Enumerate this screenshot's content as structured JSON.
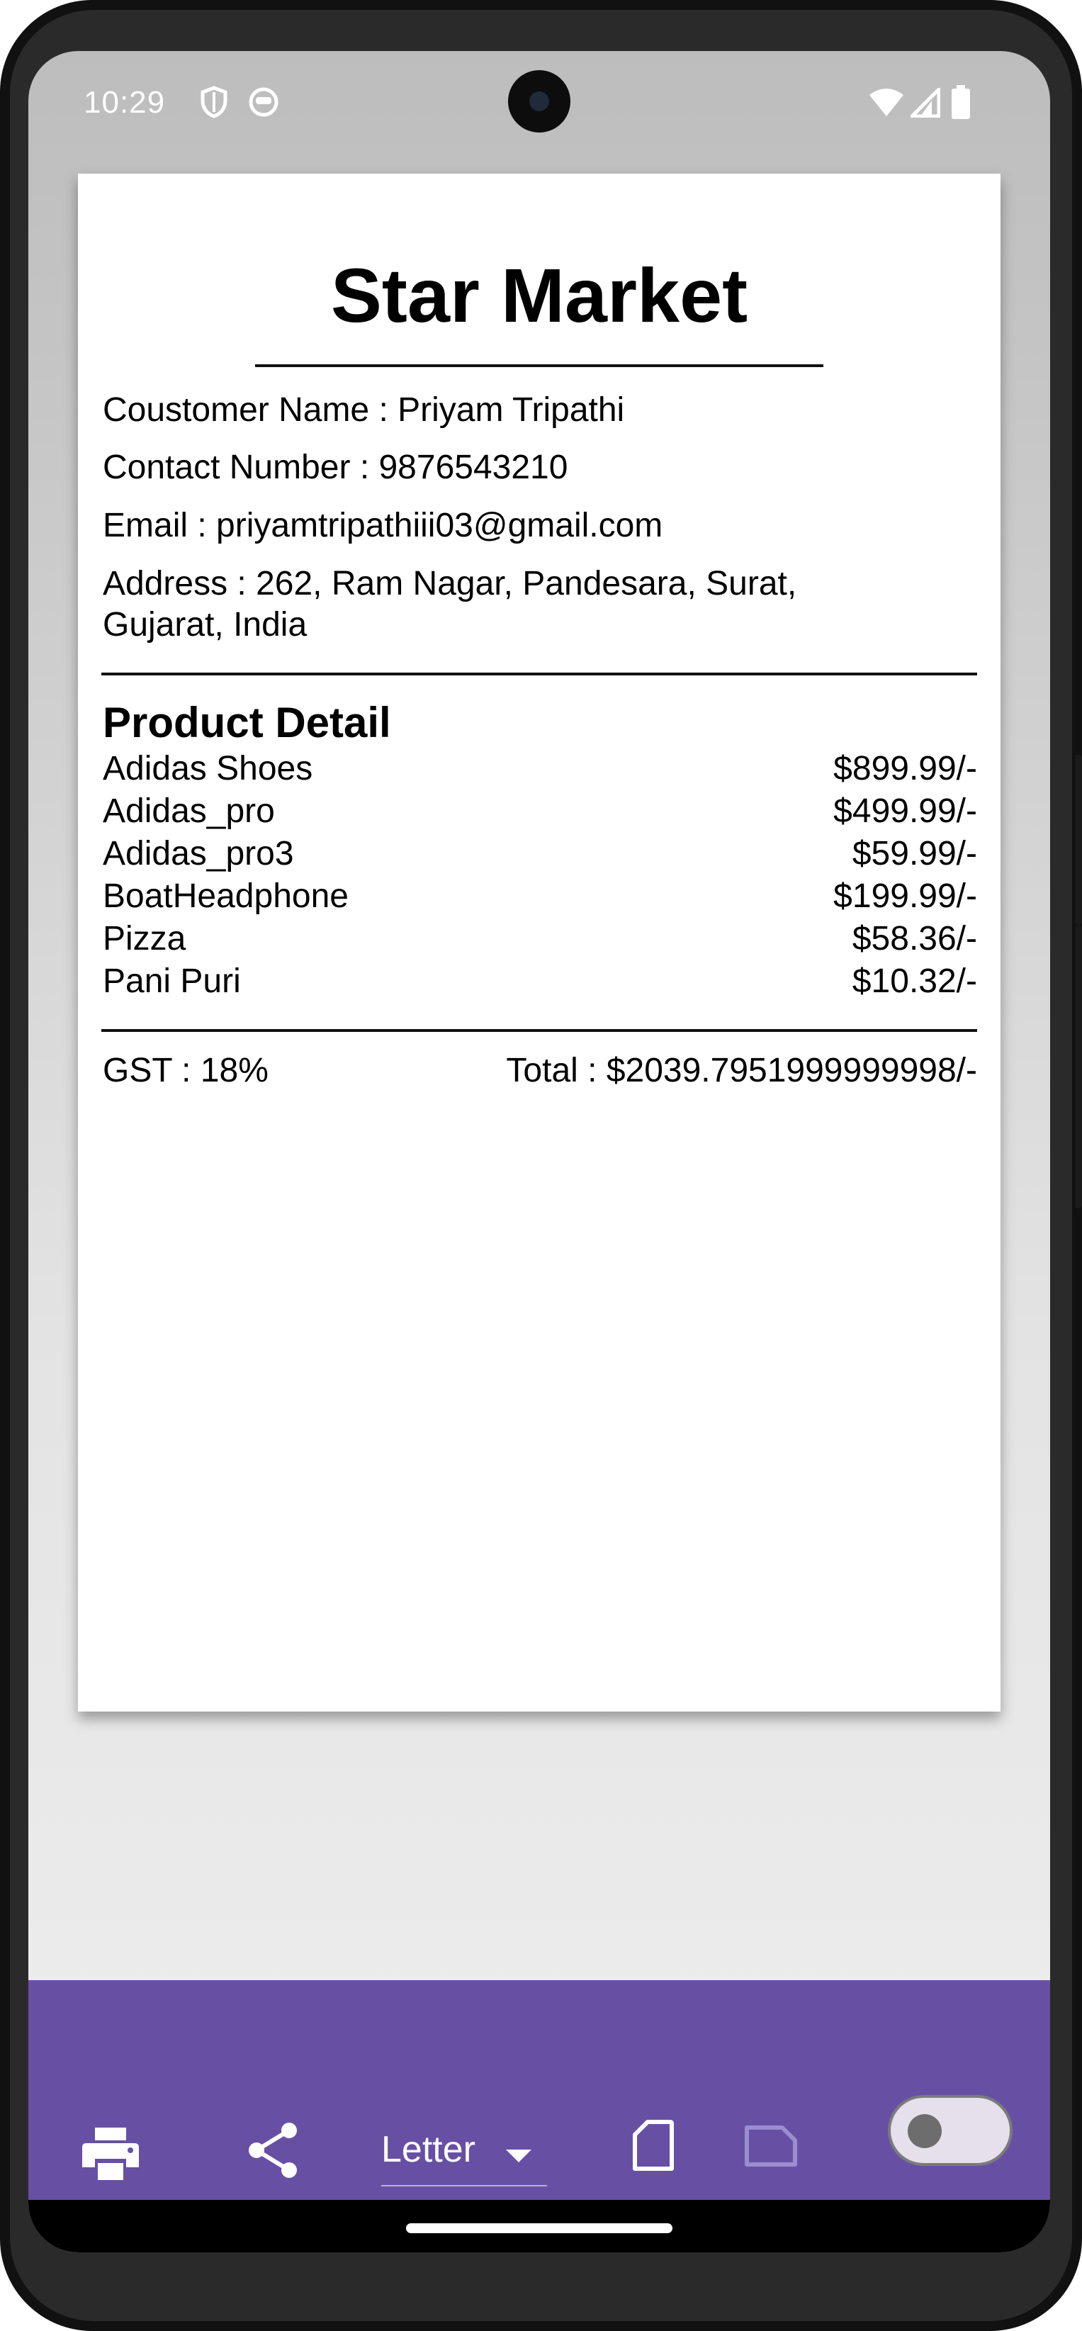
{
  "status_bar": {
    "time": "10:29"
  },
  "receipt": {
    "store_name": "Star Market",
    "customer_line": "Coustomer Name : Priyam Tripathi",
    "contact_line": "Contact Number : 9876543210",
    "email_line": "Email : priyamtripathiii03@gmail.com",
    "address_line_1": "Address : 262, Ram Nagar, Pandesara, Surat,",
    "address_line_2": "Gujarat, India",
    "product_heading": "Product Detail",
    "products": [
      {
        "name": "Adidas Shoes",
        "price": "$899.99/-"
      },
      {
        "name": "Adidas_pro",
        "price": "$499.99/-"
      },
      {
        "name": "Adidas_pro3",
        "price": "$59.99/-"
      },
      {
        "name": "BoatHeadphone",
        "price": "$199.99/-"
      },
      {
        "name": "Pizza",
        "price": "$58.36/-"
      },
      {
        "name": "Pani Puri",
        "price": "$10.32/-"
      }
    ],
    "gst_line": "GST : 18%",
    "total_line": "Total : $2039.7951999999998/-"
  },
  "toolbar": {
    "paper_size": "Letter",
    "icons": [
      "print-icon",
      "share-icon",
      "dropdown-arrow-icon",
      "portrait-icon",
      "landscape-icon"
    ],
    "toggle_on": false,
    "accent_color": "#6750a4"
  }
}
